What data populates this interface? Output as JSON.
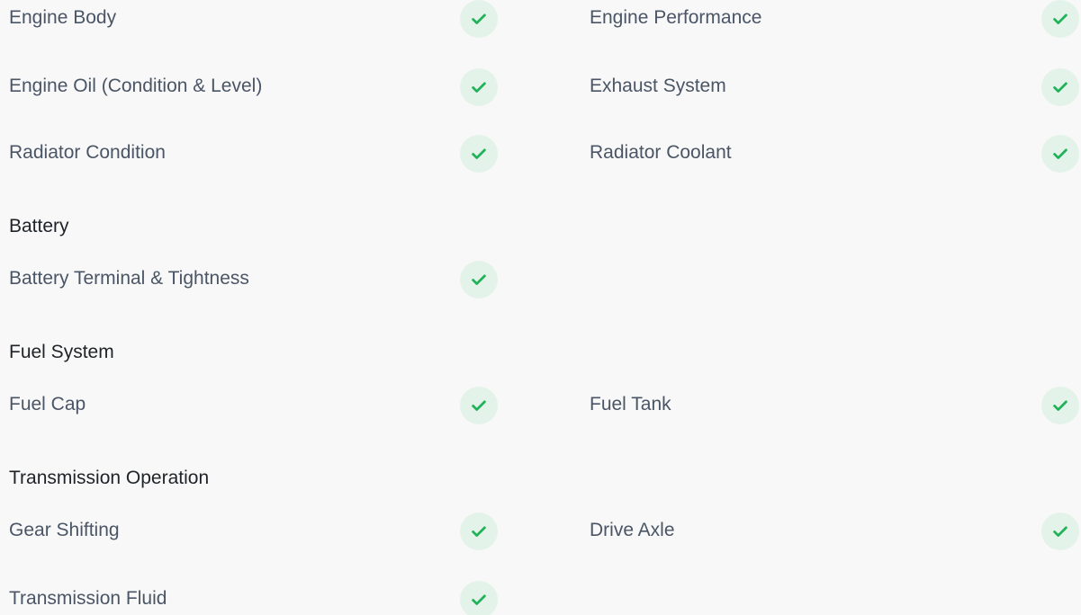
{
  "accent_color": "#21b259",
  "check_bg_color": "#e3f3e9",
  "rows": [
    {
      "left": {
        "label": "Engine Body",
        "status": "check-icon"
      },
      "right": {
        "label": "Engine Performance",
        "status": "check-icon"
      }
    },
    {
      "left": {
        "label": "Engine Oil (Condition & Level)",
        "status": "check-icon"
      },
      "right": {
        "label": "Exhaust System",
        "status": "check-icon"
      }
    },
    {
      "left": {
        "label": "Radiator Condition",
        "status": "check-icon"
      },
      "right": {
        "label": "Radiator Coolant",
        "status": "check-icon"
      }
    }
  ],
  "sections": [
    {
      "title": "Battery",
      "rows": [
        {
          "left": {
            "label": "Battery Terminal & Tightness",
            "status": "check-icon"
          }
        }
      ]
    },
    {
      "title": "Fuel System",
      "rows": [
        {
          "left": {
            "label": "Fuel Cap",
            "status": "check-icon"
          },
          "right": {
            "label": "Fuel Tank",
            "status": "check-icon"
          }
        }
      ]
    },
    {
      "title": "Transmission Operation",
      "rows": [
        {
          "left": {
            "label": "Gear Shifting",
            "status": "check-icon"
          },
          "right": {
            "label": "Drive Axle",
            "status": "check-icon"
          }
        },
        {
          "left": {
            "label": "Transmission Fluid",
            "status": "check-icon"
          }
        }
      ]
    }
  ]
}
